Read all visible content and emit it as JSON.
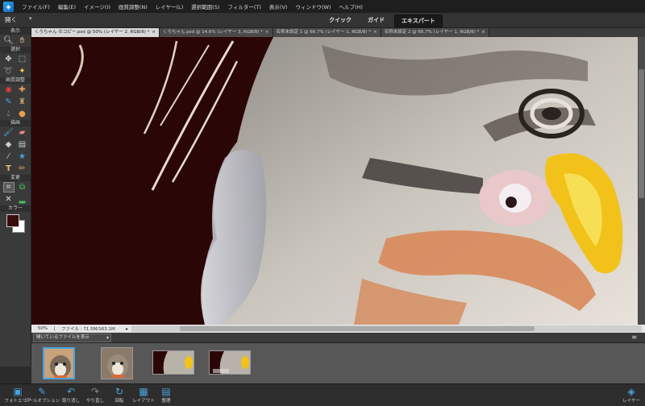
{
  "menubar": {
    "items": [
      "ファイル(F)",
      "編集(E)",
      "イメージ(I)",
      "画質調整(N)",
      "レイヤー(L)",
      "選択範囲(S)",
      "フィルター(T)",
      "表示(V)",
      "ウィンドウ(W)",
      "ヘルプ(H)"
    ]
  },
  "modebar": {
    "open_label": "開く",
    "tabs": [
      {
        "label": "クイック",
        "active": false
      },
      {
        "label": "ガイド",
        "active": false
      },
      {
        "label": "エキスパート",
        "active": true
      }
    ]
  },
  "toolbox": {
    "sections": [
      "表示",
      "選択",
      "画質調整",
      "描画",
      "変更",
      "カラー"
    ],
    "foreground_color": "#3a0b0b",
    "background_color": "#ffffff"
  },
  "doc_tabs": [
    {
      "label": "くろちゃん のコピー.psd @ 50% (レイヤー 2, RGB/8) *",
      "active": true
    },
    {
      "label": "くろちゃん.psd @ 14.6% (レイヤー 3, RGB/8) *",
      "active": false
    },
    {
      "label": "名称未設定 1 @ 66.7% (レイヤー 1, RGB/8) *",
      "active": false
    },
    {
      "label": "名称未設定 2 @ 66.7% (レイヤー 1, RGB/8) *",
      "active": false
    }
  ],
  "status": {
    "zoom": "50%",
    "file_info": "ファイル : 71.5M/163.1M"
  },
  "photo_bin": {
    "filter_label": "開いているファイルを表示"
  },
  "taskbar": {
    "buttons": [
      "フォトエリア",
      "ツールオプション",
      "取り消し",
      "やり直し",
      "回転",
      "レイアウト",
      "整理"
    ],
    "layers_label": "レイヤー"
  }
}
